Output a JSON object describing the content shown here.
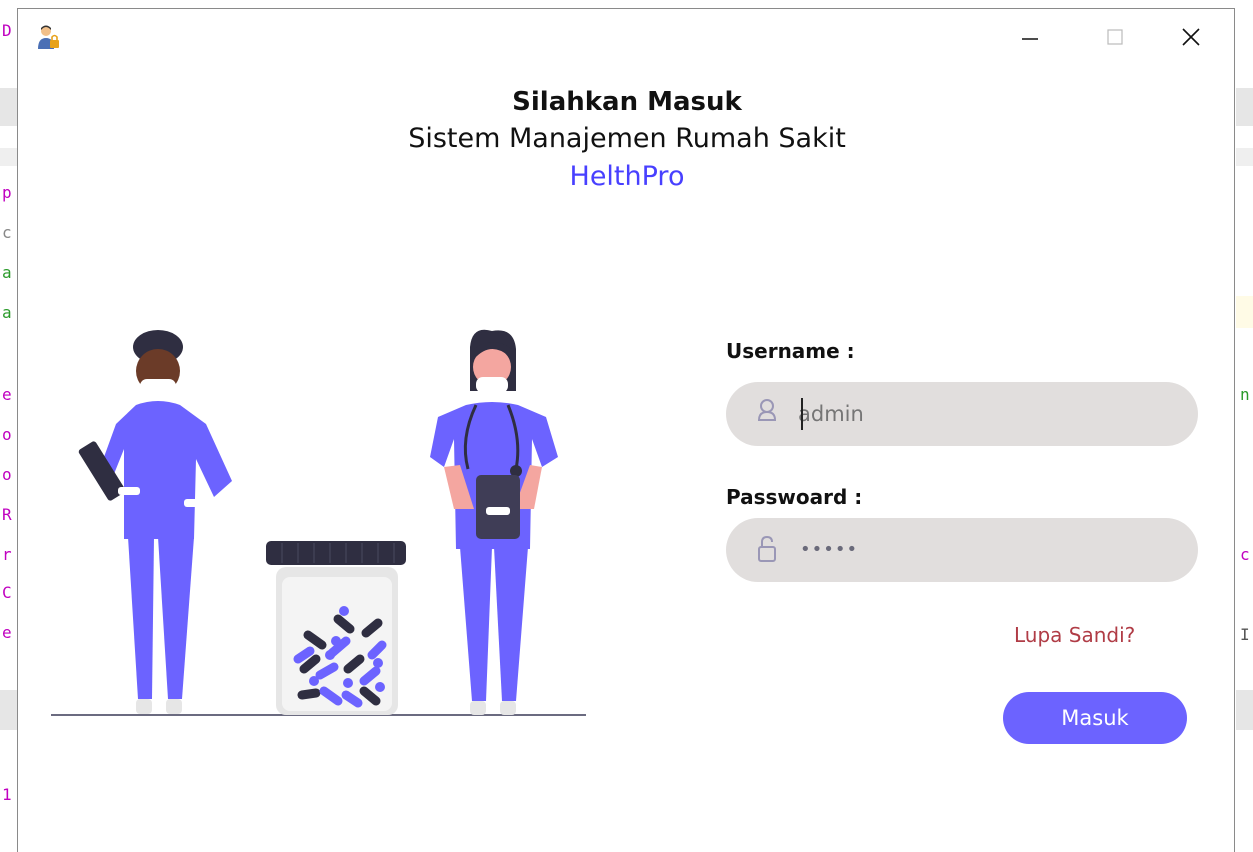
{
  "window": {
    "heading": "Silahkan Masuk",
    "subtitle": "Sistem Manajemen Rumah Sakit",
    "brand": "HelthPro"
  },
  "colors": {
    "accent": "#6c63ff",
    "brand_text": "#4840ff",
    "link": "#b03c46",
    "field_bg": "#e1dedd"
  },
  "form": {
    "username_label": "Username :",
    "username_placeholder": "admin",
    "password_label": "Passwoard :",
    "password_masked": "•••••",
    "forgot_link": "Lupa Sandi?",
    "submit_label": "Masuk"
  },
  "icons": {
    "app": "doctor-lock-icon",
    "username": "user-icon",
    "password": "unlock-icon",
    "minimize": "minimize-icon",
    "maximize": "maximize-icon",
    "close": "close-icon"
  }
}
